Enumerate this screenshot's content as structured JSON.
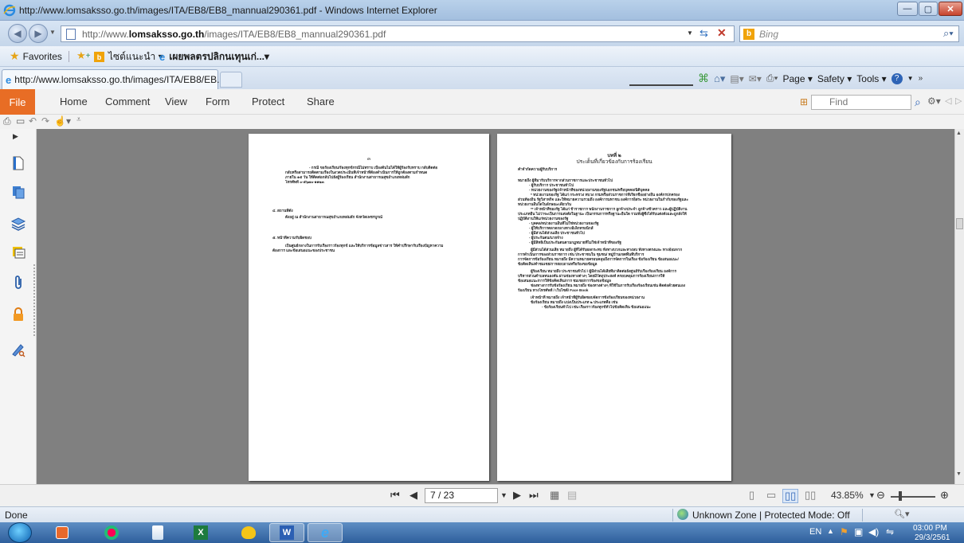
{
  "window": {
    "title": "http://www.lomsaksso.go.th/images/ITA/EB8/EB8_mannual290361.pdf - Windows Internet Explorer"
  },
  "addressbar": {
    "url_prefix": "http://www.",
    "url_domain": "lomsaksso.go.th",
    "url_path": "/images/ITA/EB8/EB8_mannual290361.pdf",
    "search_placeholder": "Bing"
  },
  "favorites": {
    "label": "Favorites",
    "items": [
      {
        "label": "ไซต์แนะนำ ▾"
      },
      {
        "label": "เผยพลตรปลิกนเทุนเก่...▾"
      }
    ]
  },
  "tab": {
    "label": "http://www.lomsaksso.go.th/images/ITA/EB8/EB..."
  },
  "commandbar": {
    "page_label": "Page ▾",
    "safety_label": "Safety ▾",
    "tools_label": "Tools ▾"
  },
  "ribbon": {
    "file_label": "File",
    "menu": [
      {
        "label": "Home"
      },
      {
        "label": "Comment"
      },
      {
        "label": "View"
      },
      {
        "label": "Form"
      },
      {
        "label": "Protect"
      },
      {
        "label": "Share"
      }
    ],
    "find_placeholder": "Find"
  },
  "document": {
    "left_page": {
      "header_mark": "๓",
      "para1": [
        "- กรณี ขอร้องเรียน/ร้องทุกข์กรณีไม่ทราบ เบื้องต้นไม่ได้ให้ผู้ร้องรับทราบ กลับติดต่อ",
        "กลับหรือสามารถติดตามเรื่องในงวดประเมินที่เจ้าหน้าที่ต้องดำเนินการให้ถูกต้องตามกำหนด",
        "ภายใน ๑๕ วัน ให้ติดต่อกลับไปยังผู้ร้องเรียน สำนักงานสาธารณสุขอำเภอหล่มสัก",
        "โทรศัพท์ ๐-๕๖๗๐-๑๑๒๓"
      ],
      "section4_title": "๔. สถานที่ตั้ง",
      "section4_text": "ตั้งอยู่ ณ สำนักงานสาธารณสุขอำเภอหล่มสัก จังหวัดเพชรบูรณ์",
      "section5_title": "๕. หน้าที่ความรับผิดชอบ",
      "section5_text": [
        "เป็นศูนย์กลางในการรับเรื่องราวร้องทุกข์ และให้บริการข้อมูลข่าวสาร ให้คำปรึกษารับเรื่องปัญหาความ",
        "ต้องการ และข้อเสนอแนะของประชาชน"
      ]
    },
    "right_page": {
      "chapter": "บทที่ ๒",
      "title": "ประเด็นที่เกี่ยวข้องกับการร้องเรียน",
      "heading": "คำจำกัดความผู้รับบริการ",
      "lines": [
        "หมายถึง ผู้ที่มารับบริการจากส่วนราชการและประชาชนทั่วไป",
        "- ผู้รับบริการ ประชาชนทั่วไป",
        "- หน่วยงานของรัฐ/เจ้าหน้าที่ของหน่วยงานของรัฐ/เอกชน/หรือบุคคล/นิติบุคคล",
        "* หน่วยงานของรัฐ ได้แก่ กระทรวง ทบวง กรมหรือส่วนราชการที่เรียกชื่ออย่างอื่น องค์กรปกครอง",
        "ส่วนท้องถิ่น รัฐวิสาหกิจ และให้หมายความรวมถึง องค์การมหาชน องค์การอิสระ หน่วยงานในกำกับของรัฐและ",
        "หน่วยงานอื่นใดในลักษณะเดียวกัน",
        "** เจ้าหน้าที่ของรัฐ ได้แก่ ข้าราชการ พนักงานราชการ ลูกจ้างประจำ ลูกจ้างชั่วคราว และผู้ปฏิบัติงาน",
        "ประเภทอื่น ไม่ว่าจะเป็นการแต่งตั้งในฐานะ เป็นกรรมการหรือฐานะอื่นใด รวมทั้งผู้ซึ่งได้รับแต่งตั้งและถูกสั่งให้",
        "ปฏิบัติงานให้แก่หน่วยงานของรัฐ",
        "- บุคคล/หน่วยงานอื่นที่ไม่ใช่หน่วยงานของรัฐ",
        "- ผู้ให้บริการตลาดกลางทางอิเล็กทรอนิกส์",
        "- ผู้มีส่วนได้ส่วนเสีย ประชาชนทั่วไป",
        "- ผู้ประกันตน/นายจ้าง",
        "- ผู้มีสิทธิเป็นประกันตนตามกฎหมายที่ไม่ใช่เจ้าหน้าที่ของรัฐ",
        "ผู้มีส่วนได้ส่วนเสีย หมายถึง ผู้ที่ได้รับผลกระทบ ทั้งทางบวกและทางลบ ทั้งทางตรงและ ทางอ้อมจาก",
        "การดำเนินการของส่วนราชการ เช่น ประชาชนใน ชุมชน/ หมู่บ้านเขตพื้นที่บริการ",
        "การจัดการข้อร้องเรียน หมายถึง มีความหมายครอบคลุมถึงการจัดการในเรื่อง ข้อร้องเรียน ข้อเสนอแนะ/",
        "ข้อคิดเห็น/คำชมเชย/การสอบถามหรือร้องขอข้อมูล",
        "ผู้ร้องเรียน หมายถึง ประชาชนทั่วไป / ผู้มีส่วนได้เสียที่มาติดต่อยังศูนย์รับเรื่องร้องเรียน องค์การ",
        "บริหารส่วนตำบลหนองคัน ผ่านช่องทางต่างๆ โดยมีวัตถุประสงค์ ครอบคลุมการร้องเรียน/การให้",
        "ข้อเสนอแนะ/การให้ข้อคิดเห็น/การ ชมเชย/การร้องขอข้อมูล",
        "ช่องทางการรับข้อร้องเรียน หมายถึง ช่องทางต่างๆ ที่ใช้ในการรับเรื่องร้องเรียนเช่น ติดต่อด้วยตนเอง",
        "ร้องเรียน ทางโทรศัพท์ / เว็บไซต์/ Face Book",
        "เจ้าหน้าที่ หมายถึง เจ้าหน้าที่ผู้รับผิดชอบจัดการข้อร้องเรียนของหน่วยงาน",
        "ข้อร้องเรียน หมายถึง แบ่งเป็นประเภท ๒ ประเภทคือ เช่น",
        "- ข้อร้องเรียนทั่วไป เช่น เรื่องราวร้องทุกข์ทั่วไปข้อคิดเห็น ข้อเสนอแนะ"
      ]
    }
  },
  "navbar": {
    "page_value": "7 / 23",
    "zoom_value": "43.85%"
  },
  "statusbar": {
    "left_text": "Done",
    "zone_text": "Unknown Zone | Protected Mode: Off"
  },
  "taskbar": {
    "lang": "EN",
    "time": "03:00 PM",
    "date": "29/3/2561"
  }
}
